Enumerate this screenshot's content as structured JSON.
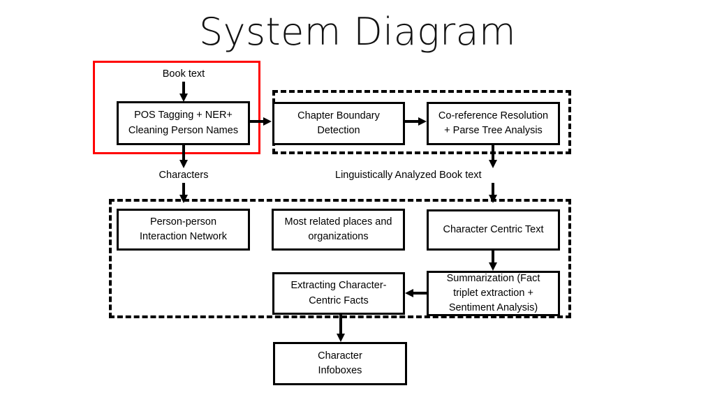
{
  "title": "System Diagram",
  "colors": {
    "highlight_box": "#FF0000",
    "stroke": "#000000",
    "background": "#FFFFFF"
  },
  "labels": {
    "book_text": "Book text",
    "characters": "Characters",
    "linguistically_analyzed": "Linguistically Analyzed Book text"
  },
  "groups": {
    "preprocessing_highlight": "",
    "nlp_pipeline_group": "",
    "analysis_group": ""
  },
  "boxes": {
    "pos_tagging": "POS Tagging + NER+\nCleaning Person Names",
    "pos_tagging_line1": "POS Tagging + NER+",
    "pos_tagging_line2": "Cleaning Person Names",
    "chapter_boundary_line1": "Chapter Boundary",
    "chapter_boundary_line2": "Detection",
    "coreference_line1": "Co-reference Resolution",
    "coreference_line2": "+ Parse Tree Analysis",
    "person_network_line1": "Person-person",
    "person_network_line2": "Interaction Network",
    "places_orgs_line1": "Most related places and",
    "places_orgs_line2": "organizations",
    "character_centric_text": "Character Centric Text",
    "extracting_facts_line1": "Extracting Character-",
    "extracting_facts_line2": "Centric Facts",
    "summarization_line1": "Summarization (Fact",
    "summarization_line2": "triplet extraction +",
    "summarization_line3": "Sentiment Analysis)",
    "character_infoboxes_line1": "Character",
    "character_infoboxes_line2": "Infoboxes"
  }
}
